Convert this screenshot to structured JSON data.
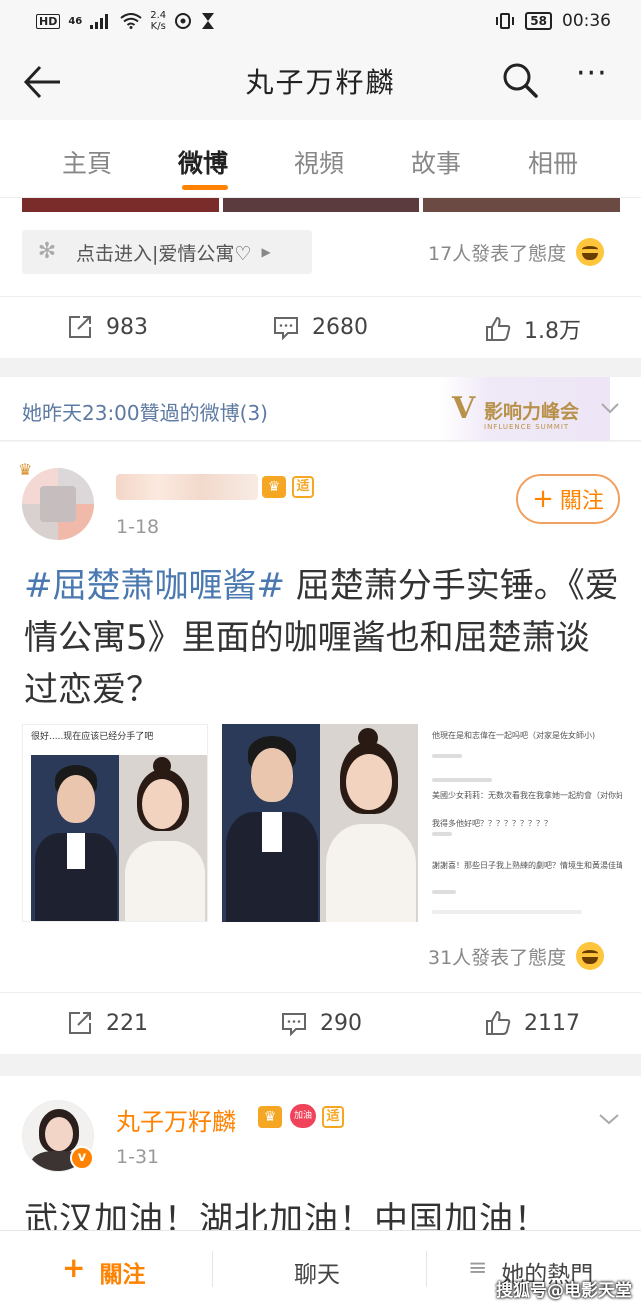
{
  "status_bar": {
    "hd": "HD",
    "network": "46",
    "speed_value": "2.4",
    "speed_unit": "K/s",
    "battery": "58",
    "time": "00:36"
  },
  "header": {
    "title": "丸子万籽麟",
    "icons": [
      "back-arrow-icon",
      "search-icon",
      "more-icon"
    ]
  },
  "tabs": [
    {
      "label": "主頁",
      "active": false
    },
    {
      "label": "微博",
      "active": true
    },
    {
      "label": "視頻",
      "active": false
    },
    {
      "label": "故事",
      "active": false
    },
    {
      "label": "相冊",
      "active": false
    }
  ],
  "accent_color": "#ff8200",
  "link_color": "#4a78b0",
  "post1": {
    "topic_chip": "点击进入|爱情公寓♡",
    "reactions": "17人發表了態度",
    "repost_count": "983",
    "comment_count": "2680",
    "like_count": "1.8万"
  },
  "liked_bar": {
    "text": "她昨天23:00贊過的微博(3)",
    "badge_v": "V",
    "badge_text": "影响力峰会",
    "badge_sub": "INFLUENCE SUMMIT"
  },
  "post2": {
    "time": "1-18",
    "follow_label": "關注",
    "hashtag": "#屈楚萧咖喱酱#",
    "text_rest": "屈楚萧分手实锤。《爱情公寓5》里面的咖喱酱也和屈楚萧谈过恋爱？",
    "image1_caption": "很好.....现在应该已经分手了吧",
    "image3_lines": [
      "他現在是和志偉在一起吗吧（对家是佐女師小)",
      "美國少女莉莉：无数次看我在我拿她一起約會（对你好女孩小薯)",
      "我得多他好吧？？？？？？？？？",
      "謝謝喜！那些日子我上熟練的劇吧？情境生和黃湯佳瑋新的開拍在一起沒"
    ],
    "reactions": "31人發表了態度",
    "repost_count": "221",
    "comment_count": "290",
    "like_count": "2117"
  },
  "post3": {
    "name": "丸子万籽麟",
    "heart_badge": "加油",
    "verified": "v",
    "time": "1-31",
    "text": "武汉加油！湖北加油！中国加油！"
  },
  "bottom_bar": {
    "follow_label": "關注",
    "chat_label": "聊天",
    "hot_label": "她的熱門"
  },
  "watermark": "搜狐号@电影天堂"
}
